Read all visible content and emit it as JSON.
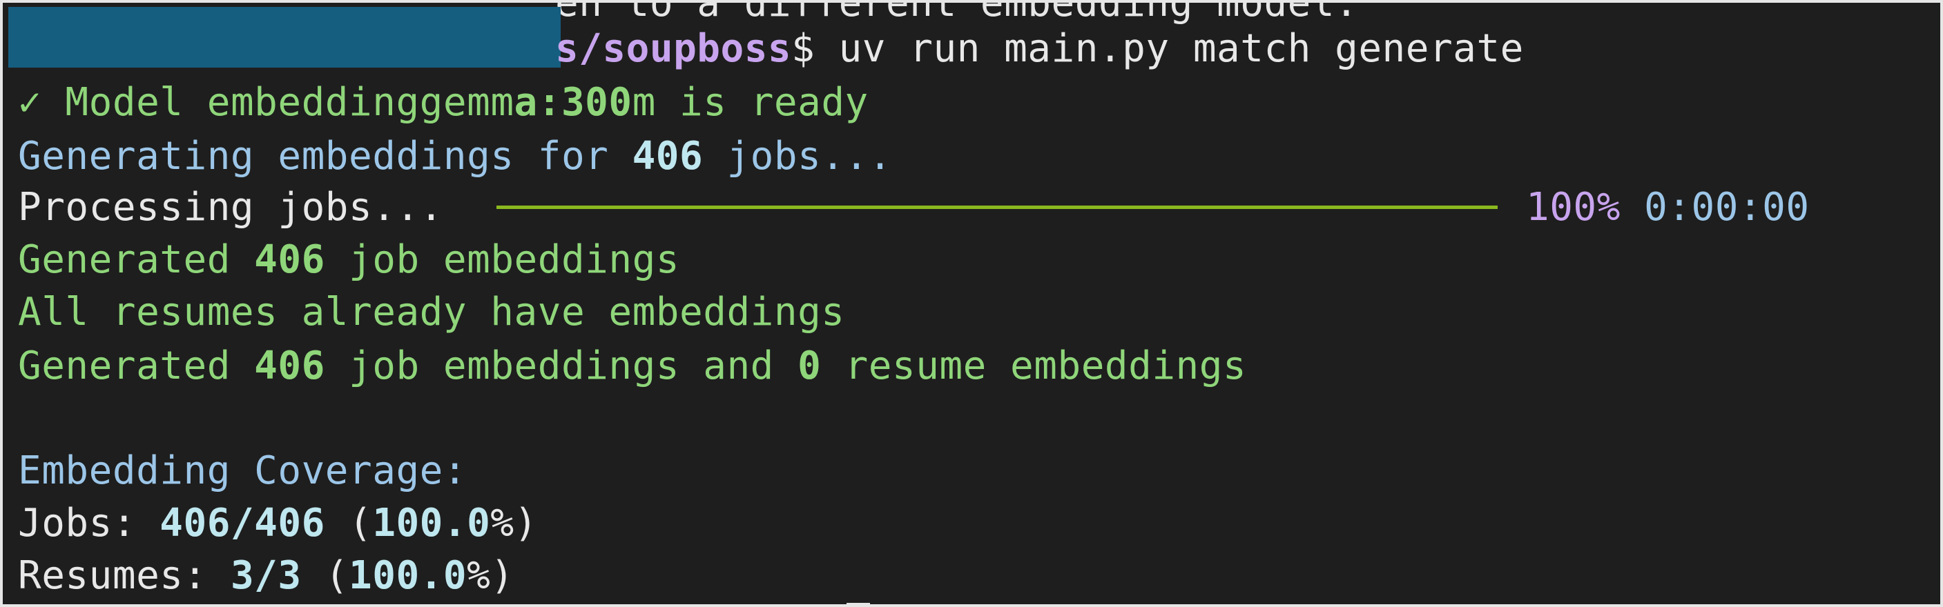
{
  "terminal": {
    "clipped_line": "en to a different embedding model.",
    "prompt_path": "s/soupboss",
    "prompt_symbol": "$",
    "command": " uv run main.py match generate",
    "model_check": "✓",
    "model_word": " Model ",
    "model_name_a": "embeddinggemm",
    "model_name_b": "a:300",
    "model_name_c": "m",
    "model_status": " is ready",
    "gen_prefix": "Generating embeddings for ",
    "gen_count": "406",
    "gen_suffix": " jobs...",
    "processing_label": "Processing jobs... ",
    "progress_percent_text": "100%",
    "progress_fraction": 1.0,
    "elapsed": "0:00:00",
    "generated_prefix": "Generated ",
    "generated_count": "406",
    "generated_suffix": " job embeddings",
    "resumes_line": "All resumes already have embeddings",
    "summary_prefix": "Generated ",
    "summary_jobs": "406",
    "summary_mid": " job embeddings and ",
    "summary_resumes": "0",
    "summary_suffix": " resume embeddings",
    "coverage_heading": "Embedding Coverage:",
    "jobs_label": "Jobs: ",
    "jobs_value": "406/406",
    "jobs_paren_open": " (",
    "jobs_percent": "100.0",
    "jobs_percent_close": "%)",
    "resumes_label": "Resumes: ",
    "resumes_value": "3/3",
    "resumes_paren_open": " (",
    "resumes_percent": "100.0",
    "resumes_percent_close": "%)"
  },
  "colors": {
    "background": "#1e1e1e",
    "text": "#e8e8e8",
    "success_green": "#8fd67a",
    "info_blue": "#9cc6e8",
    "path_violet": "#c8a4ee",
    "progress_bar": "#8bb81f",
    "redaction": "#155e80"
  }
}
